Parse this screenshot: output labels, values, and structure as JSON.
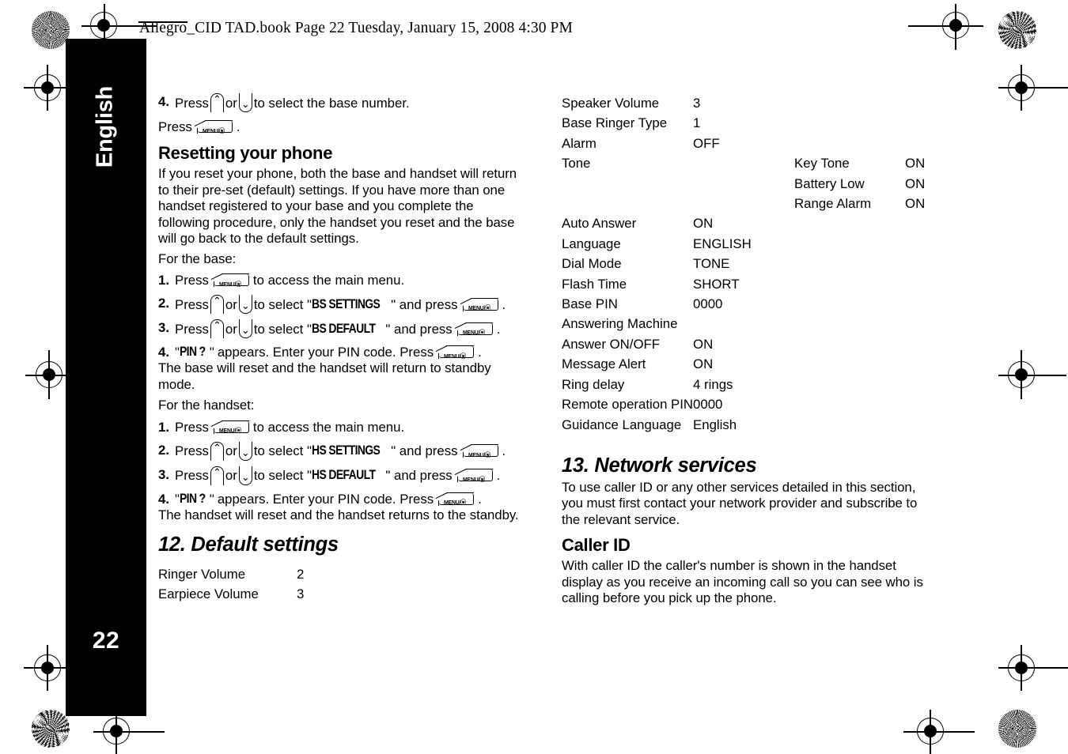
{
  "document_header": "Allegro_CID TAD.book  Page 22  Tuesday, January 15, 2008  4:30 PM",
  "sidebar": {
    "language_tab": "English",
    "page_number": "22"
  },
  "icons": {
    "menu_key_label": "MENU/ⓦ",
    "up_key_glyph": "⌃",
    "down_key_glyph": "⌄"
  },
  "left_column": {
    "step4_intro": {
      "number": "4.",
      "text_before": "Press",
      "text_or": "or",
      "text_after": "to select the base number."
    },
    "press_line": {
      "text_before": "Press",
      "text_after": "."
    },
    "resetting_heading": "Resetting your phone",
    "resetting_paragraph": "If you reset your phone, both the base and handset will return to their pre-set (default) settings. If you have more than one handset registered to your base and you complete the following procedure, only the handset you reset and the base will go back to the default settings.",
    "for_the_base_label": "For the base:",
    "base_steps": [
      {
        "number": "1.",
        "before": "Press",
        "after": "to access the main menu."
      },
      {
        "number": "2.",
        "before": "Press",
        "or": "or",
        "mid": "to select \"",
        "menu_label": "BS SETTINGS",
        "mid2": "\" and press",
        "after": "."
      },
      {
        "number": "3.",
        "before": "Press",
        "or": "or",
        "mid": "to select \"",
        "menu_label": "BS DEFAULT",
        "mid2": "\" and press",
        "after": "."
      },
      {
        "number": "4.",
        "quote_open": "\"",
        "menu_label": "PIN ?",
        "quote_close": "\"",
        "mid": "appears. Enter your PIN code. Press",
        "after": "."
      }
    ],
    "base_result": "The base will reset and the handset will return to standby mode.",
    "for_the_handset_label": "For the handset:",
    "handset_steps": [
      {
        "number": "1.",
        "before": "Press",
        "after": "to access the main menu."
      },
      {
        "number": "2.",
        "before": "Press",
        "or": "or",
        "mid": "to select \"",
        "menu_label": "HS SETTINGS",
        "mid2": "\" and press",
        "after": "."
      },
      {
        "number": "3.",
        "before": "Press",
        "or": "or",
        "mid": "to select \"",
        "menu_label": "HS DEFAULT",
        "mid2": "\" and press",
        "after": "."
      },
      {
        "number": "4.",
        "quote_open": "\"",
        "menu_label": "PIN ?",
        "quote_close": "\"",
        "mid": "appears. Enter your PIN code. Press",
        "after": "."
      }
    ],
    "handset_result": "The handset will reset and the handset returns to the standby.",
    "default_settings_heading": "12. Default settings",
    "default_settings_rows": [
      {
        "name": "Ringer Volume",
        "value": "2"
      },
      {
        "name": "Earpiece Volume",
        "value": "3"
      }
    ]
  },
  "right_column": {
    "settings_rows": [
      {
        "name": "Speaker Volume",
        "value": "3",
        "sub": "",
        "subvalue": ""
      },
      {
        "name": "Base Ringer Type",
        "value": "1",
        "sub": "",
        "subvalue": ""
      },
      {
        "name": "Alarm",
        "value": "OFF",
        "sub": "",
        "subvalue": ""
      },
      {
        "name": "Tone",
        "value": "",
        "sub": "Key Tone",
        "subvalue": "ON"
      },
      {
        "name": "",
        "value": "",
        "sub": "Battery Low",
        "subvalue": "ON"
      },
      {
        "name": "",
        "value": "",
        "sub": "Range Alarm",
        "subvalue": "ON"
      },
      {
        "name": "Auto Answer",
        "value": "ON",
        "sub": "",
        "subvalue": ""
      },
      {
        "name": "Language",
        "value": "ENGLISH",
        "sub": "",
        "subvalue": ""
      },
      {
        "name": "Dial Mode",
        "value": "TONE",
        "sub": "",
        "subvalue": ""
      },
      {
        "name": "Flash Time",
        "value": "SHORT",
        "sub": "",
        "subvalue": ""
      },
      {
        "name": "Base PIN",
        "value": "0000",
        "sub": "",
        "subvalue": ""
      },
      {
        "name": "Answering Machine",
        "value": "",
        "sub": "",
        "subvalue": ""
      },
      {
        "name": "Answer ON/OFF",
        "value": "ON",
        "sub": "",
        "subvalue": ""
      },
      {
        "name": "Message Alert",
        "value": "ON",
        "sub": "",
        "subvalue": ""
      },
      {
        "name": "Ring delay",
        "value": "4 rings",
        "sub": "",
        "subvalue": ""
      },
      {
        "name": "Remote operation PIN",
        "value": "0000",
        "sub": "",
        "subvalue": ""
      },
      {
        "name": "Guidance Language",
        "value": "English",
        "sub": "",
        "subvalue": ""
      }
    ],
    "network_services_heading": "13. Network services",
    "network_services_paragraph": "To use caller ID or any other services detailed in this section, you must first contact your network provider and subscribe to the relevant service.",
    "caller_id_heading": "Caller ID",
    "caller_id_paragraph": "With caller ID the caller's number is shown in the handset display as you receive an incoming call so you can see who is calling before you pick up the phone."
  }
}
